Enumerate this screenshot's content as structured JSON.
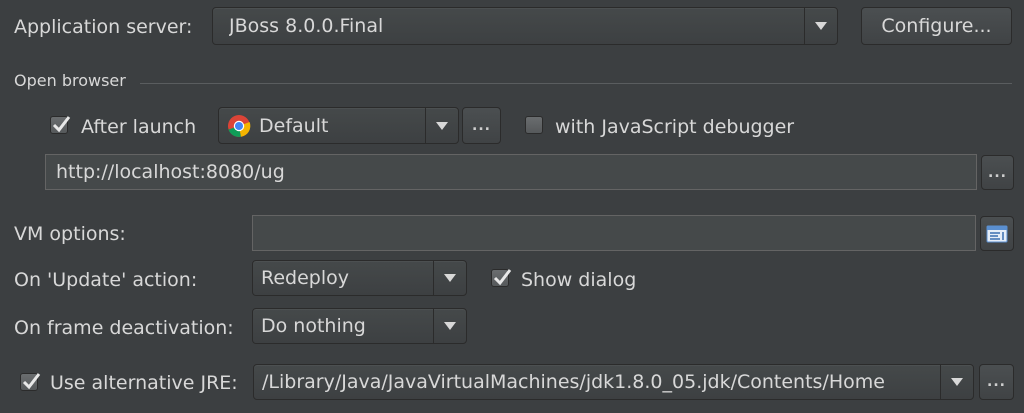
{
  "server": {
    "label": "Application server:",
    "value": "JBoss 8.0.0.Final",
    "configure_label": "Configure..."
  },
  "browser": {
    "section_title": "Open browser",
    "after_launch_label": "After launch",
    "after_launch_checked": true,
    "browser_value": "Default",
    "browse_button": "...",
    "js_debugger_label": "with JavaScript debugger",
    "js_debugger_checked": false,
    "url": "http://localhost:8080/ug",
    "url_button": "..."
  },
  "vm": {
    "label": "VM options:",
    "value": ""
  },
  "update": {
    "label": "On 'Update' action:",
    "value": "Redeploy",
    "show_dialog_label": "Show dialog",
    "show_dialog_checked": true
  },
  "deactivation": {
    "label": "On frame deactivation:",
    "value": "Do nothing"
  },
  "jre": {
    "label": "Use alternative JRE:",
    "checked": true,
    "path": "/Library/Java/JavaVirtualMachines/jdk1.8.0_05.jdk/Contents/Home",
    "browse_button": "..."
  },
  "icons": {
    "dropdown": "chevron-down-icon",
    "chrome": "chrome-icon",
    "expand": "expand-editor-icon",
    "check": "checkmark-icon"
  }
}
